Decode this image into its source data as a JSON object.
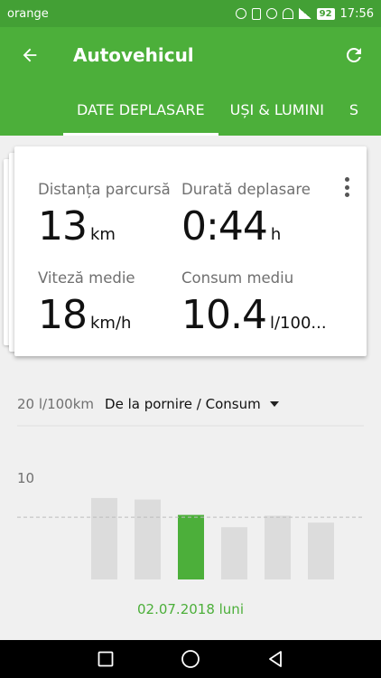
{
  "status_bar": {
    "carrier": "orange",
    "battery": "92",
    "time": "17:56"
  },
  "app_bar": {
    "title": "Autovehicul"
  },
  "tabs": [
    {
      "label": "DATE DEPLASARE",
      "active": true
    },
    {
      "label": "UȘI & LUMINI",
      "active": false
    },
    {
      "label": "S",
      "active": false
    }
  ],
  "card": {
    "metrics": [
      {
        "label": "Distanța parcursă",
        "value": "13",
        "unit": "km"
      },
      {
        "label": "Durată deplasare",
        "value": "0:44",
        "unit": "h"
      },
      {
        "label": "Viteză medie",
        "value": "18",
        "unit": "km/h"
      },
      {
        "label": "Consum mediu",
        "value": "10.4",
        "unit": "l/100..."
      }
    ]
  },
  "chart_header": {
    "y_max_label": "20 l/100km",
    "dropdown_label": "De la pornire / Consum"
  },
  "chart_data": {
    "type": "bar",
    "ylabel": "l/100km",
    "ylim": [
      0,
      20
    ],
    "y_ticks": [
      "10"
    ],
    "reference_value": 8.1,
    "values": [
      10.6,
      10.4,
      8.4,
      6.8,
      8.3,
      7.4
    ],
    "highlight_index": 2,
    "colors": {
      "bar": "#dcdcdc",
      "highlight": "#4caf3a",
      "reference": "#bdbdbd"
    }
  },
  "date_label": "02.07.2018 luni",
  "colors": {
    "primary": "#4caf3a",
    "status": "#43a035"
  }
}
